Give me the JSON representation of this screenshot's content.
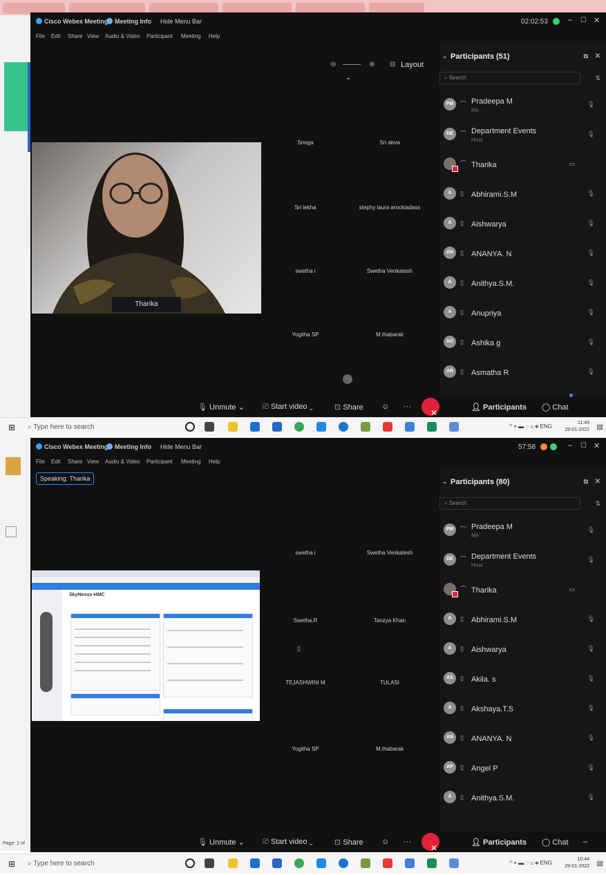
{
  "shot1": {
    "title": "Cisco Webex Meetings",
    "meeting_info": "Meeting Info",
    "hide_menu": "Hide Menu Bar",
    "timer": "02:02:53",
    "menu": [
      "File",
      "Edit",
      "Share",
      "View",
      "Audio & Video",
      "Participant",
      "Meeting",
      "Help"
    ],
    "layout_label": "Layout",
    "active_video_name": "Tharika",
    "video_names": [
      "Snega",
      "Sri deva",
      "Sri lekha",
      "stephy laura arockiadass",
      "swetha i",
      "Swetha Venkatesh",
      "Yogitha SP",
      "M.thabarak"
    ],
    "participants_header": "Participants (51)",
    "search_placeholder": "Search",
    "participants": [
      {
        "initials": "PM",
        "name": "Pradeepa M",
        "role": "Me",
        "avatar_color": "#8f8f8f"
      },
      {
        "initials": "DE",
        "name": "Department Events",
        "role": "Host",
        "avatar_color": "#8f8f8f"
      },
      {
        "initials": "",
        "name": "Tharika",
        "role": "",
        "avatar_color": "#7a6f68"
      },
      {
        "initials": "A",
        "name": "Abhirami.S.M",
        "role": "",
        "avatar_color": "#8f8f8f"
      },
      {
        "initials": "A",
        "name": "Aishwarya",
        "role": "",
        "avatar_color": "#8f8f8f"
      },
      {
        "initials": "AN",
        "name": "ANANYA. N",
        "role": "",
        "avatar_color": "#8f8f8f"
      },
      {
        "initials": "A",
        "name": "Anithya.S.M.",
        "role": "",
        "avatar_color": "#8f8f8f"
      },
      {
        "initials": "A",
        "name": "Anupriya",
        "role": "",
        "avatar_color": "#8f8f8f"
      },
      {
        "initials": "AG",
        "name": "Ashika g",
        "role": "",
        "avatar_color": "#8f8f8f"
      },
      {
        "initials": "AR",
        "name": "Asmatha R",
        "role": "",
        "avatar_color": "#8f8f8f"
      }
    ],
    "controls": {
      "unmute": "Unmute",
      "start_video": "Start video",
      "share": "Share",
      "participants": "Participants",
      "chat": "Chat"
    },
    "taskbar": {
      "search": "Type here to search",
      "time": "11:49",
      "date": "29-01-2022",
      "lang": "ENG"
    }
  },
  "shot2": {
    "title": "Cisco Webex Meetings",
    "meeting_info": "Meeting Info",
    "hide_menu": "Hide Menu Bar",
    "timer": "57:58",
    "menu": [
      "File",
      "Edit",
      "Share",
      "View",
      "Audio & Video",
      "Participant",
      "Meeting",
      "Help"
    ],
    "speaking": "Speaking: Tharika",
    "share_title": "SkyNexus-HMC",
    "video_names": [
      "swetha i",
      "Swetha Venkatesh",
      "Swetha.R",
      "Tanzya Khan",
      "TEJASHWINI M",
      "TULASI",
      "Yogitha SP",
      "M.thabarak"
    ],
    "participants_header": "Participants (80)",
    "search_placeholder": "Search",
    "participants": [
      {
        "initials": "PM",
        "name": "Pradeepa M",
        "role": "Me",
        "avatar_color": "#8f8f8f"
      },
      {
        "initials": "DE",
        "name": "Department Events",
        "role": "Host",
        "avatar_color": "#8f8f8f"
      },
      {
        "initials": "",
        "name": "Tharika",
        "role": "",
        "avatar_color": "#7a6f68"
      },
      {
        "initials": "A",
        "name": "Abhirami.S.M",
        "role": "",
        "avatar_color": "#8f8f8f"
      },
      {
        "initials": "A",
        "name": "Aishwarya",
        "role": "",
        "avatar_color": "#8f8f8f"
      },
      {
        "initials": "AS",
        "name": "Akila. s",
        "role": "",
        "avatar_color": "#8f8f8f"
      },
      {
        "initials": "A",
        "name": "Akshaya.T.S",
        "role": "",
        "avatar_color": "#8f8f8f"
      },
      {
        "initials": "AN",
        "name": "ANANYA. N",
        "role": "",
        "avatar_color": "#8f8f8f"
      },
      {
        "initials": "AP",
        "name": "Angel P",
        "role": "",
        "avatar_color": "#8f8f8f"
      },
      {
        "initials": "A",
        "name": "Anithya.S.M.",
        "role": "",
        "avatar_color": "#8f8f8f"
      }
    ],
    "controls": {
      "unmute": "Unmute",
      "start_video": "Start video",
      "share": "Share",
      "participants": "Participants",
      "chat": "Chat"
    },
    "taskbar": {
      "search": "Type here to search",
      "time": "10:44",
      "date": "29-01-2022",
      "lang": "ENG"
    },
    "word_page": "Page: 2 of"
  },
  "colors": {
    "webex_bg": "#111111",
    "panel_bg": "#161616",
    "end_red": "#e0213a",
    "accent_blue": "#2d8bff"
  }
}
